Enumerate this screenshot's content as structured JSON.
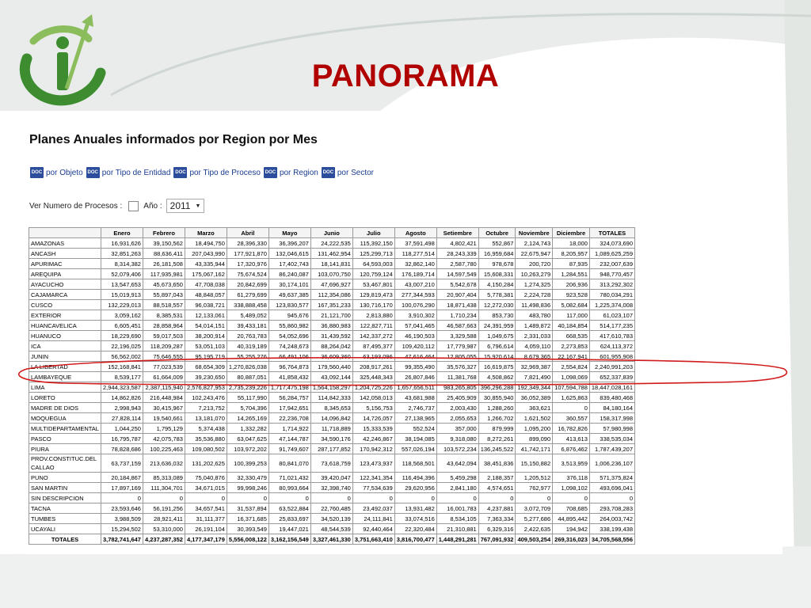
{
  "slide": {
    "title": "PANORAMA"
  },
  "report": {
    "heading": "Planes Anuales informados por Region por Mes",
    "links": [
      {
        "icon": "doc-icon",
        "label": "por Objeto"
      },
      {
        "icon": "doc-icon",
        "label": "por Tipo de Entidad"
      },
      {
        "icon": "doc-icon",
        "label": "por Tipo de Proceso"
      },
      {
        "icon": "doc-icon",
        "label": "por Region"
      },
      {
        "icon": "doc-icon",
        "label": "por Sector"
      }
    ],
    "filters": {
      "ver_numero_label": "Ver Numero de Procesos :",
      "anio_label": "Año :",
      "year_value": "2011"
    }
  },
  "colors": {
    "title": "#b00000",
    "highlight_ellipse": "#d11a1a",
    "logo_green": "#3d8c2f"
  },
  "table": {
    "headers": [
      "",
      "Enero",
      "Febrero",
      "Marzo",
      "Abril",
      "Mayo",
      "Junio",
      "Julio",
      "Agosto",
      "Setiembre",
      "Octubre",
      "Noviembre",
      "Diciembre",
      "TOTALES"
    ],
    "rows": [
      [
        "AMAZONAS",
        "16,931,626",
        "39,150,562",
        "18,494,750",
        "28,396,330",
        "36,396,207",
        "24,222,535",
        "115,392,150",
        "37,591,498",
        "4,802,421",
        "552,867",
        "2,124,743",
        "18,000",
        "324,073,690"
      ],
      [
        "ANCASH",
        "32,851,263",
        "88,636,411",
        "207,043,990",
        "177,921,870",
        "132,046,615",
        "131,462,954",
        "125,299,713",
        "118,277,514",
        "28,243,339",
        "16,959,684",
        "22,675,947",
        "8,205,957",
        "1,089,625,259"
      ],
      [
        "APURIMAC",
        "8,314,382",
        "26,181,508",
        "43,335,944",
        "17,320,976",
        "17,402,743",
        "18,141,831",
        "64,593,003",
        "32,862,140",
        "2,587,780",
        "978,678",
        "200,720",
        "87,935",
        "232,007,639"
      ],
      [
        "AREQUIPA",
        "52,079,406",
        "117,935,981",
        "175,067,162",
        "75,674,524",
        "86,240,087",
        "103,070,750",
        "120,759,124",
        "176,189,714",
        "14,597,549",
        "15,608,331",
        "10,263,279",
        "1,284,551",
        "948,770,457"
      ],
      [
        "AYACUCHO",
        "13,547,653",
        "45,673,650",
        "47,708,038",
        "20,842,699",
        "30,174,101",
        "47,696,927",
        "53,467,801",
        "43,007,210",
        "5,542,678",
        "4,150,284",
        "1,274,325",
        "206,936",
        "313,292,302"
      ],
      [
        "CAJAMARCA",
        "15,019,913",
        "55,897,043",
        "48,848,057",
        "61,279,699",
        "49,637,385",
        "112,354,086",
        "129,819,473",
        "277,344,593",
        "20,907,404",
        "5,778,381",
        "2,224,728",
        "923,528",
        "780,034,291"
      ],
      [
        "CUSCO",
        "132,229,013",
        "88,518,557",
        "96,038,721",
        "338,888,458",
        "123,830,577",
        "167,351,233",
        "130,716,170",
        "100,076,290",
        "18,871,438",
        "12,272,030",
        "11,498,836",
        "5,082,684",
        "1,225,374,008"
      ],
      [
        "EXTERIOR",
        "3,059,162",
        "8,385,531",
        "12,133,061",
        "5,489,052",
        "945,676",
        "21,121,700",
        "2,813,880",
        "3,910,302",
        "1,710,234",
        "853,730",
        "483,780",
        "117,000",
        "61,023,107"
      ],
      [
        "HUANCAVELICA",
        "6,605,451",
        "28,858,964",
        "54,014,151",
        "39,433,181",
        "55,860,982",
        "36,880,983",
        "122,827,711",
        "57,041,465",
        "46,587,663",
        "24,391,959",
        "1,489,872",
        "40,184,854",
        "514,177,235"
      ],
      [
        "HUANUCO",
        "18,229,690",
        "59,017,503",
        "38,200,914",
        "20,763,783",
        "54,052,696",
        "31,439,592",
        "142,337,272",
        "46,190,503",
        "3,329,588",
        "1,049,675",
        "2,331,033",
        "668,535",
        "417,610,783"
      ],
      [
        "ICA",
        "22,196,025",
        "118,209,287",
        "53,051,103",
        "40,319,189",
        "74,248,673",
        "88,264,042",
        "87,495,377",
        "109,420,112",
        "17,779,987",
        "6,796,614",
        "4,059,110",
        "2,273,853",
        "624,113,372"
      ],
      [
        "JUNIN",
        "56,562,002",
        "75,646,555",
        "95,195,719",
        "55,255,276",
        "66,491,106",
        "36,609,360",
        "63,193,096",
        "47,616,464",
        "12,805,055",
        "15,920,614",
        "8,679,365",
        "22,167,941",
        "601,955,908"
      ],
      [
        "LA LIBERTAD",
        "152,168,841",
        "77,023,539",
        "68,654,309",
        "1,270,826,038",
        "96,764,873",
        "179,560,440",
        "208,917,261",
        "99,355,490",
        "35,576,327",
        "16,619,875",
        "32,969,387",
        "2,554,824",
        "2,240,991,203"
      ],
      [
        "LAMBAYEQUE",
        "8,539,177",
        "61,664,009",
        "39,230,650",
        "80,887,051",
        "41,858,432",
        "43,092,144",
        "325,448,343",
        "26,807,846",
        "11,381,768",
        "4,508,862",
        "7,821,490",
        "1,098,069",
        "652,337,839"
      ],
      [
        "LIMA",
        "2,944,323,587",
        "2,387,115,940",
        "2,576,827,953",
        "2,735,239,226",
        "1,717,475,198",
        "1,564,158,297",
        "1,204,725,226",
        "1,657,656,511",
        "983,265,805",
        "396,296,288",
        "192,349,344",
        "107,594,788",
        "18,447,028,161"
      ],
      [
        "LORETO",
        "14,862,826",
        "216,448,984",
        "102,243,476",
        "55,117,990",
        "56,284,757",
        "114,842,333",
        "142,058,013",
        "43,681,988",
        "25,405,909",
        "30,855,940",
        "36,052,389",
        "1,625,863",
        "839,480,468"
      ],
      [
        "MADRE DE DIOS",
        "2,998,943",
        "30,415,967",
        "7,213,752",
        "5,704,396",
        "17,942,651",
        "8,345,653",
        "5,156,753",
        "2,746,737",
        "2,003,430",
        "1,288,260",
        "363,621",
        "0",
        "84,180,164"
      ],
      [
        "MOQUEGUA",
        "27,828,114",
        "19,540,661",
        "13,181,070",
        "14,265,169",
        "22,236,708",
        "14,096,842",
        "14,726,057",
        "27,138,965",
        "2,055,653",
        "1,266,702",
        "1,621,502",
        "360,557",
        "158,317,998"
      ],
      [
        "MULTIDEPARTAMENTAL",
        "1,044,250",
        "1,795,129",
        "5,374,438",
        "1,332,282",
        "1,714,922",
        "11,718,889",
        "15,333,539",
        "552,524",
        "357,000",
        "879,999",
        "1,095,200",
        "16,782,826",
        "57,980,998"
      ],
      [
        "PASCO",
        "16,795,787",
        "42,075,783",
        "35,536,880",
        "63,047,625",
        "47,144,787",
        "34,590,176",
        "42,246,867",
        "38,194,085",
        "9,318,080",
        "8,272,261",
        "899,090",
        "413,613",
        "338,535,034"
      ],
      [
        "PIURA",
        "78,828,686",
        "100,225,463",
        "109,080,502",
        "103,972,202",
        "91,749,607",
        "287,177,852",
        "170,942,312",
        "557,026,194",
        "103,572,234",
        "136,245,522",
        "41,742,171",
        "6,876,462",
        "1,787,439,207"
      ],
      [
        "PROV.CONSTITUC.DEL CALLAO",
        "63,737,159",
        "213,636,032",
        "131,202,625",
        "100,399,253",
        "80,841,070",
        "73,618,759",
        "123,473,937",
        "118,568,501",
        "43,642,094",
        "38,451,836",
        "15,150,882",
        "3,513,959",
        "1,006,236,107"
      ],
      [
        "PUNO",
        "20,184,867",
        "85,313,089",
        "75,040,876",
        "32,330,479",
        "71,021,432",
        "39,420,047",
        "122,341,354",
        "116,494,396",
        "5,459,298",
        "2,188,357",
        "1,205,512",
        "376,118",
        "571,375,824"
      ],
      [
        "SAN MARTIN",
        "17,897,169",
        "111,304,701",
        "34,671,015",
        "99,998,246",
        "80,993,664",
        "32,398,740",
        "77,534,639",
        "29,620,956",
        "2,841,180",
        "4,574,651",
        "762,977",
        "1,098,102",
        "493,696,041"
      ],
      [
        "SIN DESCRIPCION",
        "0",
        "0",
        "0",
        "0",
        "0",
        "0",
        "0",
        "0",
        "0",
        "0",
        "0",
        "0",
        "0"
      ],
      [
        "TACNA",
        "23,593,646",
        "56,191,256",
        "34,657,541",
        "31,537,894",
        "63,522,884",
        "22,760,485",
        "23,492,037",
        "13,931,482",
        "16,001,783",
        "4,237,881",
        "3,072,709",
        "708,685",
        "293,708,283"
      ],
      [
        "TUMBES",
        "3,988,509",
        "28,921,411",
        "31,111,377",
        "16,371,685",
        "25,833,697",
        "34,520,139",
        "24,111,841",
        "33,074,516",
        "8,534,105",
        "7,363,334",
        "5,277,686",
        "44,895,442",
        "264,003,742"
      ],
      [
        "UCAYALI",
        "15,294,502",
        "53,310,000",
        "26,191,104",
        "30,393,549",
        "19,447,021",
        "48,544,539",
        "92,440,464",
        "22,320,484",
        "21,310,881",
        "6,329,316",
        "2,422,635",
        "194,942",
        "338,199,438"
      ]
    ],
    "totals": [
      "TOTALES",
      "3,782,741,647",
      "4,237,287,352",
      "4,177,347,179",
      "5,556,008,122",
      "3,162,156,549",
      "3,327,461,330",
      "3,751,663,410",
      "3,816,700,477",
      "1,448,291,281",
      "767,091,932",
      "409,503,254",
      "269,316,023",
      "34,705,568,556"
    ]
  }
}
